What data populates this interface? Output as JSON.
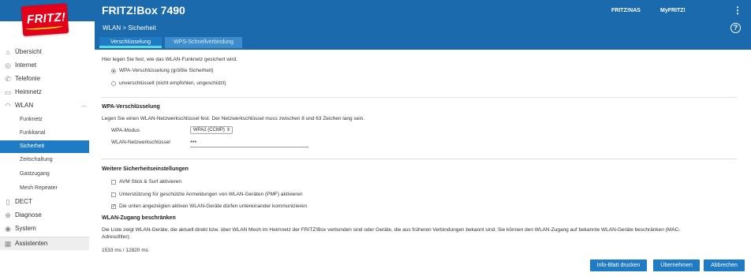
{
  "header": {
    "logo_text": "FRITZ!",
    "product": "FRITZ!Box 7490",
    "links": [
      "FRITZ!NAS",
      "MyFRITZ!"
    ],
    "menu_icon": "kebab-menu-icon"
  },
  "breadcrumb": "WLAN > Sicherheit",
  "help_label": "?",
  "tabs": [
    {
      "label": "Verschlüsselung",
      "active": true
    },
    {
      "label": "WPS-Schnellverbindung",
      "active": false
    }
  ],
  "sidebar": {
    "items": [
      {
        "label": "Übersicht",
        "icon": "home-icon",
        "glyph": "⌂"
      },
      {
        "label": "Internet",
        "icon": "globe-icon",
        "glyph": "◎"
      },
      {
        "label": "Telefonie",
        "icon": "phone-icon",
        "glyph": "✆"
      },
      {
        "label": "Heimnetz",
        "icon": "network-icon",
        "glyph": "▭"
      },
      {
        "label": "WLAN",
        "icon": "wifi-icon",
        "glyph": "◠",
        "chevron": "︿"
      },
      {
        "label": "DECT",
        "icon": "dect-icon",
        "glyph": "▯"
      },
      {
        "label": "Diagnose",
        "icon": "diagnose-icon",
        "glyph": "⊕"
      },
      {
        "label": "System",
        "icon": "system-icon",
        "glyph": "◉"
      },
      {
        "label": "Assistenten",
        "icon": "wizard-icon",
        "glyph": "▦"
      }
    ],
    "wlan_sub": [
      "Funknetz",
      "Funkkanal",
      "Sicherheit",
      "Zeitschaltung",
      "Gastzugang",
      "Mesh Repeater"
    ],
    "active_sub": "Sicherheit"
  },
  "main": {
    "intro": "Hier legen Sie fest, wie das WLAN-Funknetz gesichert wird.",
    "radio_wpa": "WPA-Verschlüsselung (größte Sicherheit)",
    "radio_none": "unverschlüsselt (nicht empfohlen, ungeschützt)",
    "wpa_title": "WPA-Verschlüsselung",
    "wpa_desc": "Legen Sie einen WLAN-Netzwerkschlüssel fest. Der Netzwerkschlüssel muss zwischen 8 und 63 Zeichen lang sein.",
    "wpa_mode_label": "WPA-Modus",
    "wpa_mode_value": "WPA2 (CCMP)",
    "key_label": "WLAN-Netzwerkschlüssel",
    "key_value": "***",
    "more_title": "Weitere Sicherheitseinstellungen",
    "check1": "AVM Stick & Surf aktivieren",
    "check2": "Unterstützung für geschützte Anmeldungen von WLAN-Geräten (PMF) aktivieren",
    "check3": "Die unten angezeigten aktiven WLAN-Geräte dürfen untereinander kommunizieren",
    "access_title": "WLAN-Zugang beschränken",
    "access_desc_1": "Die Liste zeigt WLAN-Geräte, die aktuell direkt bzw. über WLAN Mesh im Heimnetz der FRITZ!Box verbunden sind oder Geräte, die aus früheren Verbindungen bekannt sind. Sie können den WLAN-Zugang auf bekannte WLAN-Geräte beschränken (MAC-",
    "access_desc_2": "Adressfilter).",
    "timing": "1533 ms / 12820 ms"
  },
  "buttons": {
    "info": "Info-Blatt drucken",
    "apply": "Übernehmen",
    "cancel": "Abbrechen"
  },
  "colors": {
    "brand_blue": "#1a6aad",
    "active_blue": "#1e7bc4",
    "logo_red": "#e2001a",
    "tab_indicator": "#5bd8e0"
  }
}
